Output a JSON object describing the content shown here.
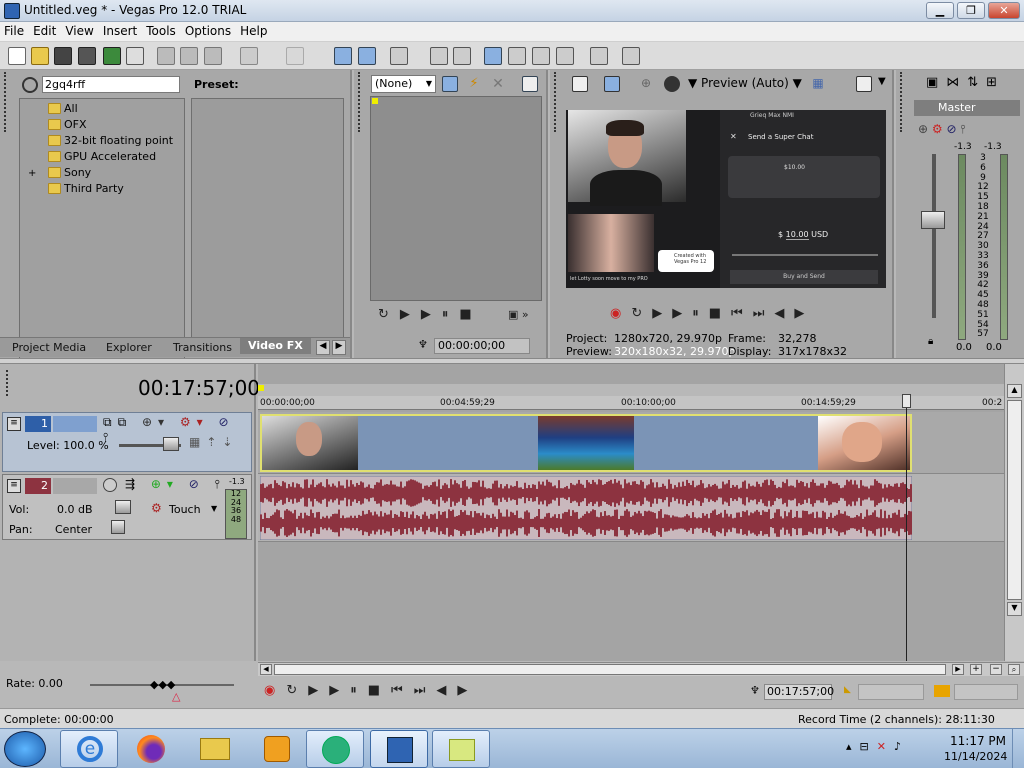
{
  "window": {
    "title": "Untitled.veg * - Vegas Pro 12.0 TRIAL"
  },
  "menu": [
    "File",
    "Edit",
    "View",
    "Insert",
    "Tools",
    "Options",
    "Help"
  ],
  "explorer": {
    "search_value": "2gq4rff",
    "preset_label": "Preset:",
    "tree": [
      "All",
      "OFX",
      "32-bit floating point",
      "GPU Accelerated",
      "Sony",
      "Third Party"
    ],
    "expand_glyph": "+",
    "tabs": [
      "Project Media",
      "Explorer",
      "Transitions",
      "Video FX"
    ]
  },
  "trimmer": {
    "dropdown": "(None)",
    "time": "00:00:00;00"
  },
  "preview": {
    "mode": "Preview (Auto)",
    "project_label": "Project:",
    "project_value": "1280x720, 29.970p",
    "preview_label": "Preview:",
    "preview_value": "320x180x32, 29.970p",
    "frame_label": "Frame:",
    "frame_value": "32,278",
    "display_label": "Display:",
    "display_value": "317x178x32",
    "screen_texts": {
      "name": "Grieq Max  NMI",
      "superchat": "Send a Super Chat",
      "amount": "$10.00",
      "field": "10.00",
      "currency": "USD",
      "buy": "Buy and Send",
      "badge": "Created with Vegas Pro 12",
      "caption": "let Lotty soon move to my PRO"
    }
  },
  "mixer": {
    "master": "Master",
    "peak_l": "-1.3",
    "peak_r": "-1.3",
    "scale": [
      "3",
      "6",
      "9",
      "12",
      "15",
      "18",
      "21",
      "24",
      "27",
      "30",
      "33",
      "36",
      "39",
      "42",
      "45",
      "48",
      "51",
      "54",
      "57"
    ],
    "out_l": "0.0",
    "out_r": "0.0"
  },
  "timeline": {
    "cursor_time": "00:17:57;00",
    "ruler": [
      "00:00:00;00",
      "00:04:59;29",
      "00:10:00;00",
      "00:14:59;29",
      "00:2"
    ],
    "video_track": {
      "number": "1",
      "level": "Level: 100.0 %"
    },
    "audio_track": {
      "number": "2",
      "vol_label": "Vol:",
      "vol_value": "0.0 dB",
      "pan_label": "Pan:",
      "pan_value": "Center",
      "mode": "Touch",
      "meter_peak": "-1.3",
      "meter_scale": [
        "12",
        "24",
        "36",
        "48"
      ]
    },
    "rate": "Rate: 0.00",
    "transport_time": "00:17:57;00"
  },
  "status": {
    "complete": "Complete: 00:00:00",
    "record": "Record Time (2 channels): 28:11:30"
  },
  "taskbar": {
    "time": "11:17 PM",
    "date": "11/14/2024"
  },
  "colors": {
    "accent": "#3a74c8",
    "audio_wave": "#8d3340",
    "track_bg": "#7b94b6"
  }
}
